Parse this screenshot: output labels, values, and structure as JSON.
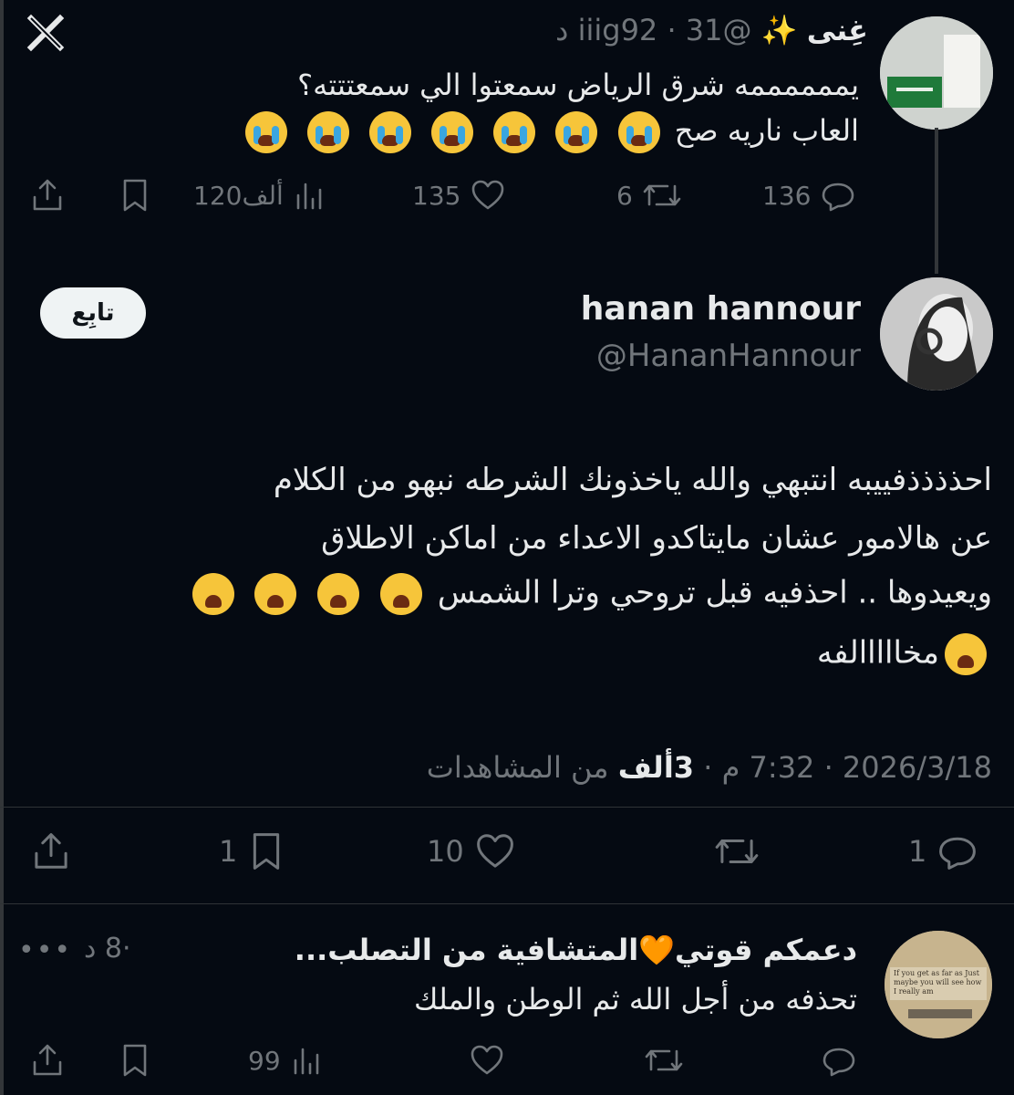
{
  "top_tweet": {
    "name": "غِنى",
    "name_emoji": "✨",
    "handle": "@iiig92",
    "time": "31 د",
    "text_line1": "يممممممه شرق الرياض سمعتوا الي سمعتتته؟",
    "text_line2": "العاب ناريه صح",
    "replies": "136",
    "retweets": "6",
    "likes": "135",
    "views": "120ألف"
  },
  "main_tweet": {
    "name": "hanan hannour",
    "handle": "@HananHannour",
    "follow_label": "تابِع",
    "text_line1": "احذذذذفييبه انتبهي والله ياخذونك الشرطه نبهو من الكلام",
    "text_line2": "عن هالامور عشان مايتاكدو الاعداء من اماكن الاطلاق",
    "text_line3": "ويعيدوها .. احذفيه قبل تروحي وترا الشمس",
    "text_line4": "مخااااالفه",
    "date": "2026/3/18",
    "time": "7:32 م",
    "views_count": "3ألف",
    "views_label": "من المشاهدات",
    "replies": "1",
    "likes": "10",
    "bookmarks": "1"
  },
  "reply_tweet": {
    "name": "دعمكم قوتي🧡المتشافية من التصلب...",
    "time": "8 د",
    "text": "تحذفه من أجل الله ثم الوطن والملك",
    "avatar_caption": "If you get as far as Just maybe you will see how I really am",
    "views": "99"
  },
  "icons": [
    "x-logo-icon",
    "reply-icon",
    "retweet-icon",
    "like-icon",
    "views-icon",
    "bookmark-icon",
    "share-icon",
    "more-icon"
  ]
}
